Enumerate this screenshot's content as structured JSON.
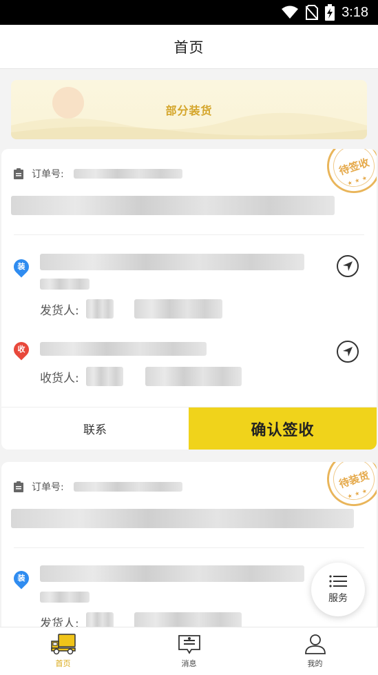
{
  "status_bar": {
    "time": "3:18"
  },
  "header": {
    "title": "首页"
  },
  "banner": {
    "text": "部分装货"
  },
  "orders": [
    {
      "order_label": "订单号:",
      "stamp": "待签收",
      "load_badge": "装",
      "shipper_label": "发货人:",
      "unload_badge": "收",
      "receiver_label": "收货人:",
      "contact_label": "联系",
      "confirm_label": "确认签收"
    },
    {
      "order_label": "订单号:",
      "stamp": "待装货",
      "load_badge": "装",
      "shipper_label": "发货人:"
    }
  ],
  "service": {
    "label": "服务"
  },
  "tabs": [
    {
      "label": "首页",
      "icon": "truck-icon",
      "active": true
    },
    {
      "label": "消息",
      "icon": "message-icon",
      "active": false
    },
    {
      "label": "我的",
      "icon": "user-icon",
      "active": false
    }
  ],
  "colors": {
    "accent": "#f0d31b",
    "tab_active": "#d9a816",
    "stamp": "#e5a94a",
    "pin_load": "#2f8cf0",
    "pin_unload": "#e8483b"
  }
}
